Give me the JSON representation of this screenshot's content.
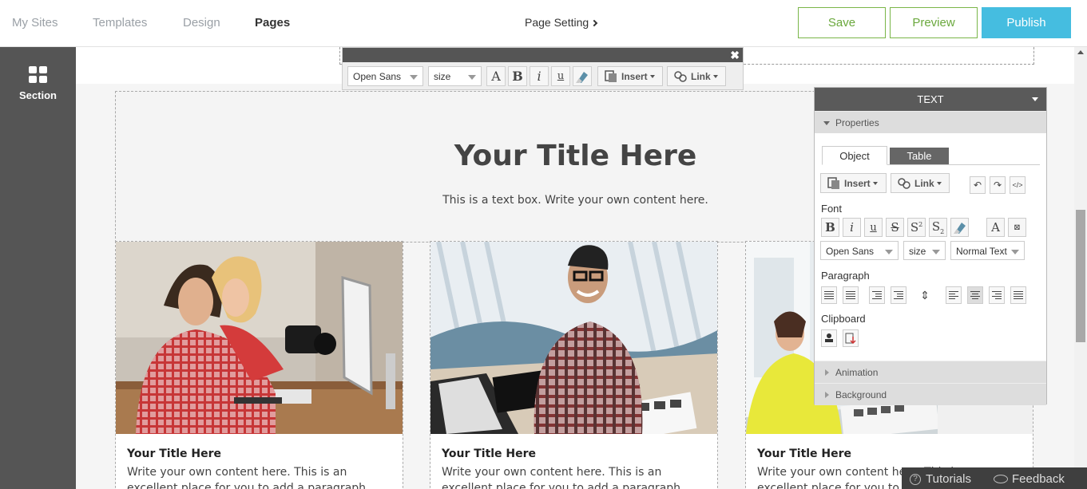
{
  "nav": {
    "items": [
      "My Sites",
      "Templates",
      "Design",
      "Pages"
    ],
    "active": "Pages",
    "page_setting": "Page Setting",
    "save": "Save",
    "preview": "Preview",
    "publish": "Publish",
    "colors": {
      "save_border": "#7ab648",
      "publish_bg": "#45bde0"
    }
  },
  "sidebar": {
    "section_label": "Section"
  },
  "toolbar": {
    "close_glyph": "✖",
    "font": "Open Sans",
    "size": "size",
    "insert": "Insert",
    "link": "Link"
  },
  "hero": {
    "title": "Your Title Here",
    "text": "This is a text box. Write your own content here."
  },
  "cards": [
    {
      "title": "Your Title Here",
      "text": "Write your own content here. This is an excellent place for you to add a paragraph."
    },
    {
      "title": "Your Title Here",
      "text": "Write your own content here. This is an excellent place for you to add a paragraph."
    },
    {
      "title": "Your Title Here",
      "text": "Write your own content here. This is an excellent place for you to add a paragraph."
    }
  ],
  "panel": {
    "header": "TEXT",
    "properties": "Properties",
    "tab_object": "Object",
    "tab_table": "Table",
    "insert": "Insert",
    "link": "Link",
    "font_label": "Font",
    "font": "Open Sans",
    "size": "size",
    "style": "Normal Text",
    "paragraph_label": "Paragraph",
    "clipboard_label": "Clipboard",
    "animation": "Animation",
    "background": "Background"
  },
  "help": {
    "tutorials": "Tutorials",
    "feedback": "Feedback"
  }
}
